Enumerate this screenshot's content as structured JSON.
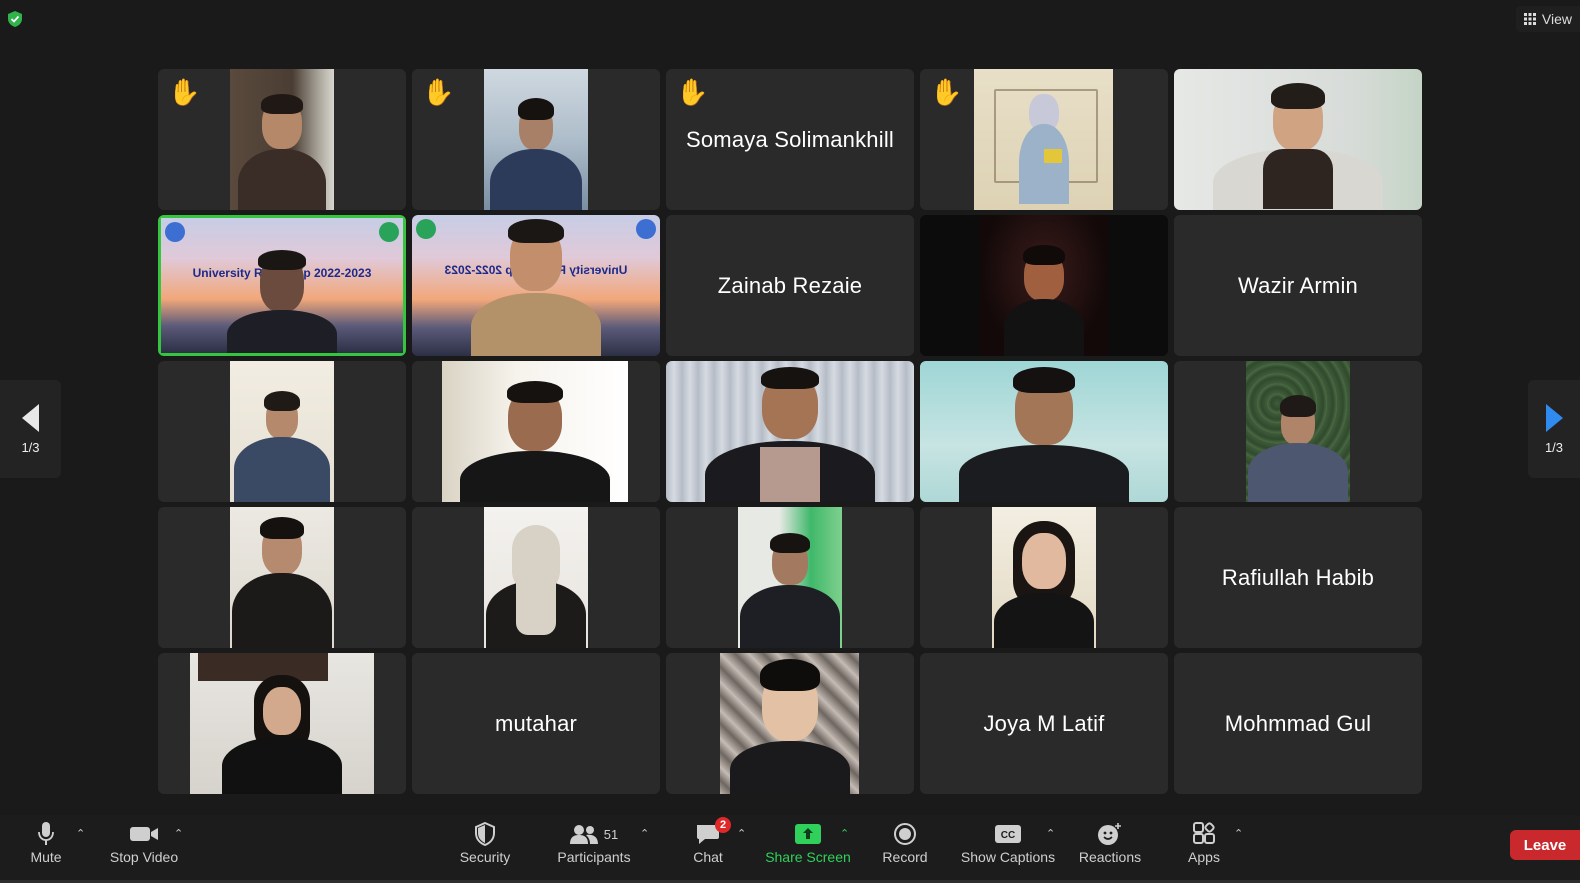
{
  "top": {
    "view_label": "View"
  },
  "tiles": [
    {
      "type": "video",
      "hand": true
    },
    {
      "type": "video",
      "hand": true
    },
    {
      "type": "name",
      "hand": true,
      "name": "Somaya Solimankhill"
    },
    {
      "type": "video",
      "hand": true
    },
    {
      "type": "video",
      "hand": false
    },
    {
      "type": "video",
      "active": true,
      "banner": "University Resea    hip 2022-2023"
    },
    {
      "type": "video",
      "banner": "University Researc   ip 2022-2023"
    },
    {
      "type": "name",
      "name": "Zainab Rezaie"
    },
    {
      "type": "video"
    },
    {
      "type": "name",
      "name": "Wazir Armin"
    },
    {
      "type": "video"
    },
    {
      "type": "video"
    },
    {
      "type": "video"
    },
    {
      "type": "video"
    },
    {
      "type": "video"
    },
    {
      "type": "video"
    },
    {
      "type": "video"
    },
    {
      "type": "video"
    },
    {
      "type": "video"
    },
    {
      "type": "name",
      "name": "Rafiullah Habib"
    },
    {
      "type": "video"
    },
    {
      "type": "name",
      "name": "mutahar"
    },
    {
      "type": "video"
    },
    {
      "type": "name",
      "name": "Joya M Latif"
    },
    {
      "type": "name",
      "name": "Mohmmad Gul"
    }
  ],
  "pager": {
    "left": "1/3",
    "right": "1/3"
  },
  "toolbar": {
    "mute": "Mute",
    "stop_video": "Stop Video",
    "security": "Security",
    "participants": "Participants",
    "participants_count": "51",
    "chat": "Chat",
    "chat_badge": "2",
    "share_screen": "Share Screen",
    "record": "Record",
    "show_captions": "Show Captions",
    "reactions": "Reactions",
    "apps": "Apps",
    "leave": "Leave"
  },
  "colors": {
    "accent_green": "#2fd15a",
    "leave_red": "#c9292c",
    "active_outline": "#36c53f"
  }
}
